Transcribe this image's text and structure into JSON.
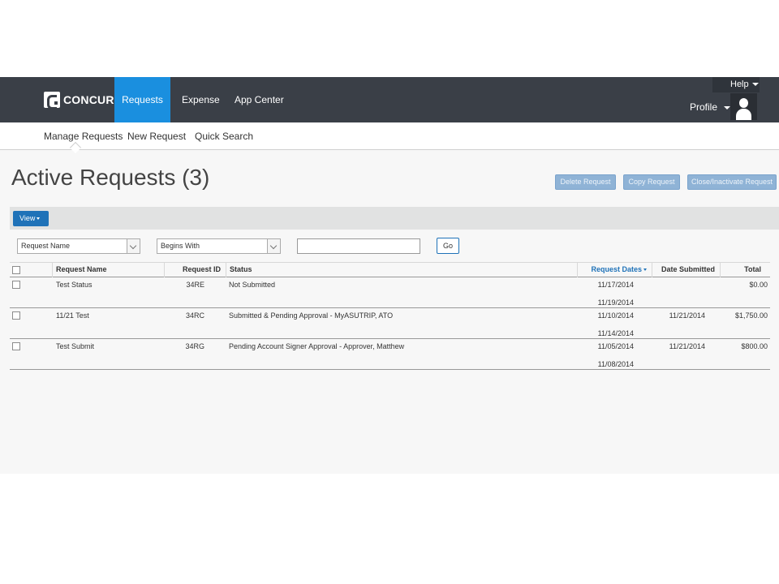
{
  "brand": {
    "logo_text": "CONCUR"
  },
  "nav": {
    "tabs": [
      {
        "label": "Requests"
      },
      {
        "label": "Expense"
      },
      {
        "label": "App Center"
      }
    ],
    "help_label": "Help",
    "profile_label": "Profile"
  },
  "subnav": {
    "items": [
      {
        "label": "Manage Requests"
      },
      {
        "label": "New Request"
      },
      {
        "label": "Quick Search"
      }
    ]
  },
  "page": {
    "title": "Active Requests (3)"
  },
  "actions": {
    "delete_label": "Delete Request",
    "copy_label": "Copy Request",
    "close_label": "Close/Inactivate Request"
  },
  "view_label": "View",
  "filter": {
    "field_value": "Request Name",
    "operator_value": "Begins With",
    "search_value": "",
    "go_label": "Go"
  },
  "table": {
    "headers": {
      "name": "Request Name",
      "id": "Request ID",
      "status": "Status",
      "dates": "Request Dates",
      "submitted": "Date Submitted",
      "total": "Total"
    },
    "rows": [
      {
        "name": "Test Status",
        "id": "34RE",
        "status": "Not Submitted",
        "start": "11/17/2014",
        "end": "11/19/2014",
        "submitted": "",
        "total": "$0.00"
      },
      {
        "name": "11/21 Test",
        "id": "34RC",
        "status": "Submitted & Pending Approval - MyASUTRIP, ATO",
        "start": "11/10/2014",
        "end": "11/14/2014",
        "submitted": "11/21/2014",
        "total": "$1,750.00"
      },
      {
        "name": "Test Submit",
        "id": "34RG",
        "status": "Pending Account Signer Approval - Approver, Matthew",
        "start": "11/05/2014",
        "end": "11/08/2014",
        "submitted": "11/21/2014",
        "total": "$800.00"
      }
    ]
  }
}
